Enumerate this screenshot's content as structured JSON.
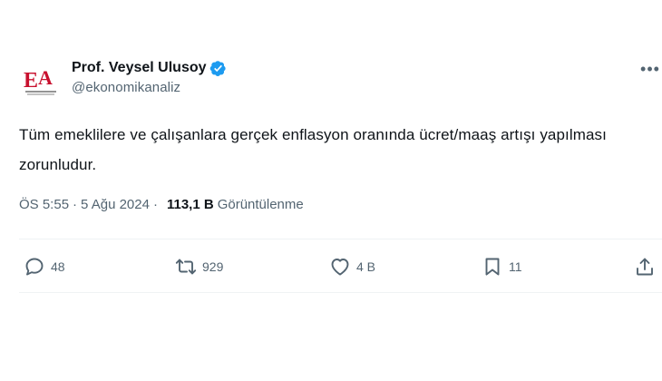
{
  "author": {
    "display_name": "Prof. Veysel Ulusoy",
    "handle": "@ekonomikanaliz",
    "avatar_logo_text": "EA",
    "avatar_icon": "ekonomik-analiz-logo",
    "verified_icon": "verified-badge-icon",
    "verified_color": "#1d9bf0"
  },
  "menu": {
    "more_label": "•••"
  },
  "tweet": {
    "text": "Tüm emeklilere ve çalışanlara gerçek enflasyon oranında ücret/maaş artışı yapılması zorunludur.",
    "time": "ÖS 5:55",
    "separator": "·",
    "date": "5 Ağu 2024",
    "views_count": "113,1 B",
    "views_label": "Görüntülenme"
  },
  "actions": {
    "reply": {
      "icon": "reply-icon",
      "count": "48"
    },
    "retweet": {
      "icon": "retweet-icon",
      "count": "929"
    },
    "like": {
      "icon": "heart-icon",
      "count": "4 B"
    },
    "bookmark": {
      "icon": "bookmark-icon",
      "count": "11"
    },
    "share": {
      "icon": "share-icon"
    }
  },
  "colors": {
    "text_primary": "#0f1419",
    "text_secondary": "#536471",
    "divider": "#eff3f4",
    "logo_red": "#c8102e"
  }
}
